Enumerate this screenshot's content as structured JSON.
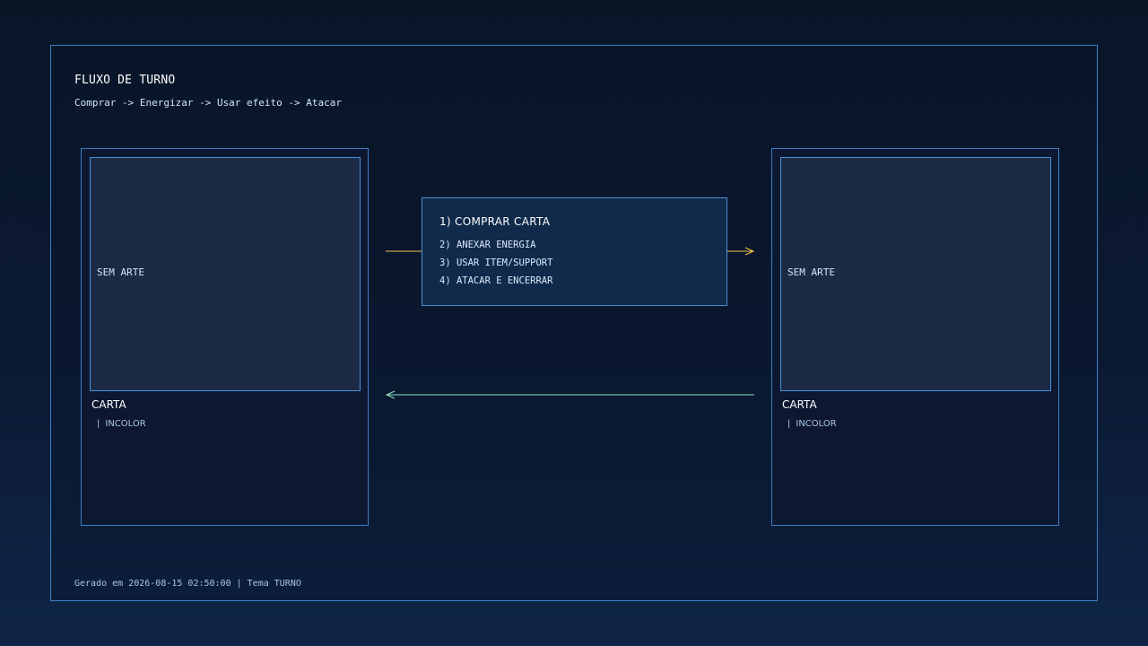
{
  "header": {
    "title": "FLUXO DE TURNO",
    "subtitle": "Comprar -> Energizar -> Usar efeito -> Atacar"
  },
  "cards": [
    {
      "art_placeholder": "SEM ARTE",
      "name": "CARTA",
      "type_separator": "|",
      "type": "INCOLOR"
    },
    {
      "art_placeholder": "SEM ARTE",
      "name": "CARTA",
      "type_separator": "|",
      "type": "INCOLOR"
    }
  ],
  "steps": {
    "main": "1) COMPRAR CARTA",
    "items": [
      "2) ANEXAR ENERGIA",
      "3) USAR ITEM/SUPPORT",
      "4) ATACAR E ENCERRAR"
    ]
  },
  "footer": {
    "text": "Gerado em 2026-08-15 02:50:00 | Tema TURNO"
  },
  "colors": {
    "forward_arrow": "#f2c14e",
    "return_arrow": "#8fe3c0",
    "border": "#3b7fc7"
  }
}
